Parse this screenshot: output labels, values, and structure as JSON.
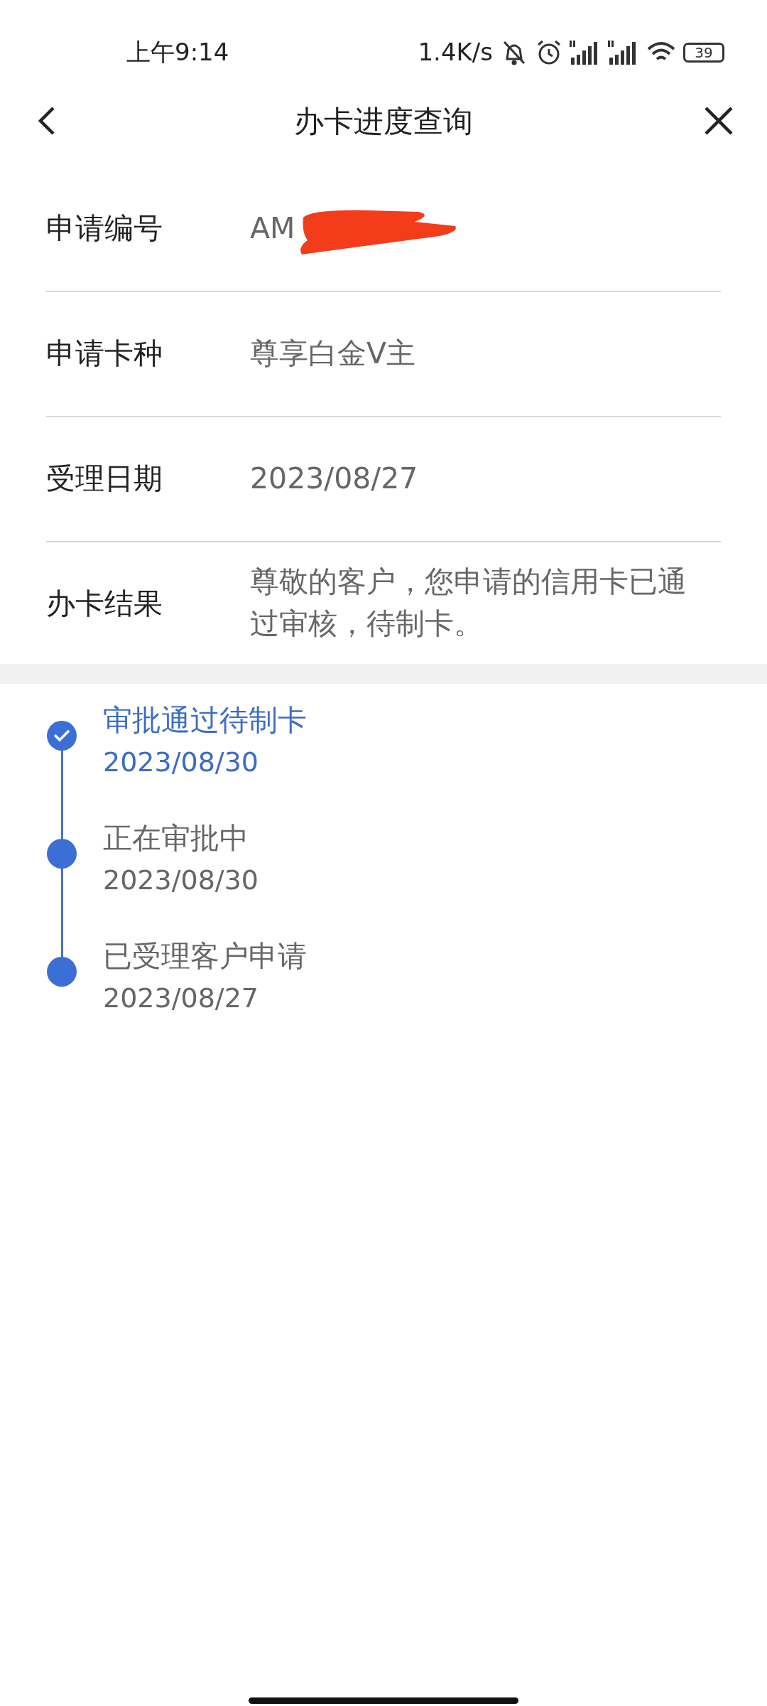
{
  "status_bar": {
    "time": "上午9:14",
    "speed": "1.4K/s",
    "battery": "39"
  },
  "header": {
    "title": "办卡进度查询"
  },
  "fields": [
    {
      "label": "申请编号",
      "value": "AM",
      "redacted": true
    },
    {
      "label": "申请卡种",
      "value": "尊享白金V主",
      "redacted": false
    },
    {
      "label": "受理日期",
      "value": "2023/08/27",
      "redacted": false
    },
    {
      "label": "办卡结果",
      "value": "尊敬的客户，您申请的信用卡已通过审核，待制卡。",
      "redacted": false
    }
  ],
  "timeline": [
    {
      "title": "审批通过待制卡",
      "date": "2023/08/30",
      "current": true
    },
    {
      "title": "正在审批中",
      "date": "2023/08/30",
      "current": false
    },
    {
      "title": "已受理客户申请",
      "date": "2023/08/27",
      "current": false
    }
  ]
}
